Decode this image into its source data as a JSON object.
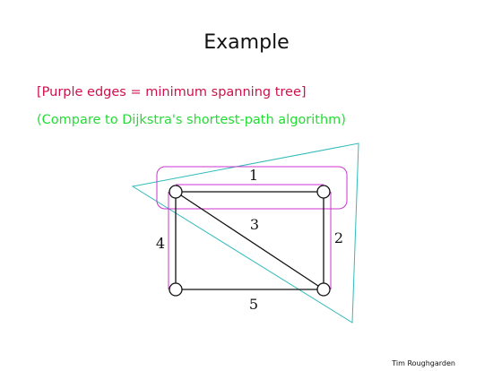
{
  "slide": {
    "title": "Example",
    "note_mst": "[Purple edges = minimum spanning tree]",
    "note_compare": "(Compare to Dijkstra's shortest-path algorithm)",
    "footer": "Tim Roughgarden"
  },
  "graph": {
    "edges": [
      {
        "id": "top",
        "weight": "1"
      },
      {
        "id": "right",
        "weight": "2"
      },
      {
        "id": "diagonal",
        "weight": "3"
      },
      {
        "id": "left",
        "weight": "4"
      },
      {
        "id": "bottom",
        "weight": "5"
      }
    ]
  },
  "colors": {
    "title": "#111111",
    "note_mst": "#d0104c",
    "note_compare": "#22dd33",
    "mst_highlight": "#cc33cc",
    "shortest_path_highlight": "#33bbbb",
    "edge": "#111111"
  }
}
